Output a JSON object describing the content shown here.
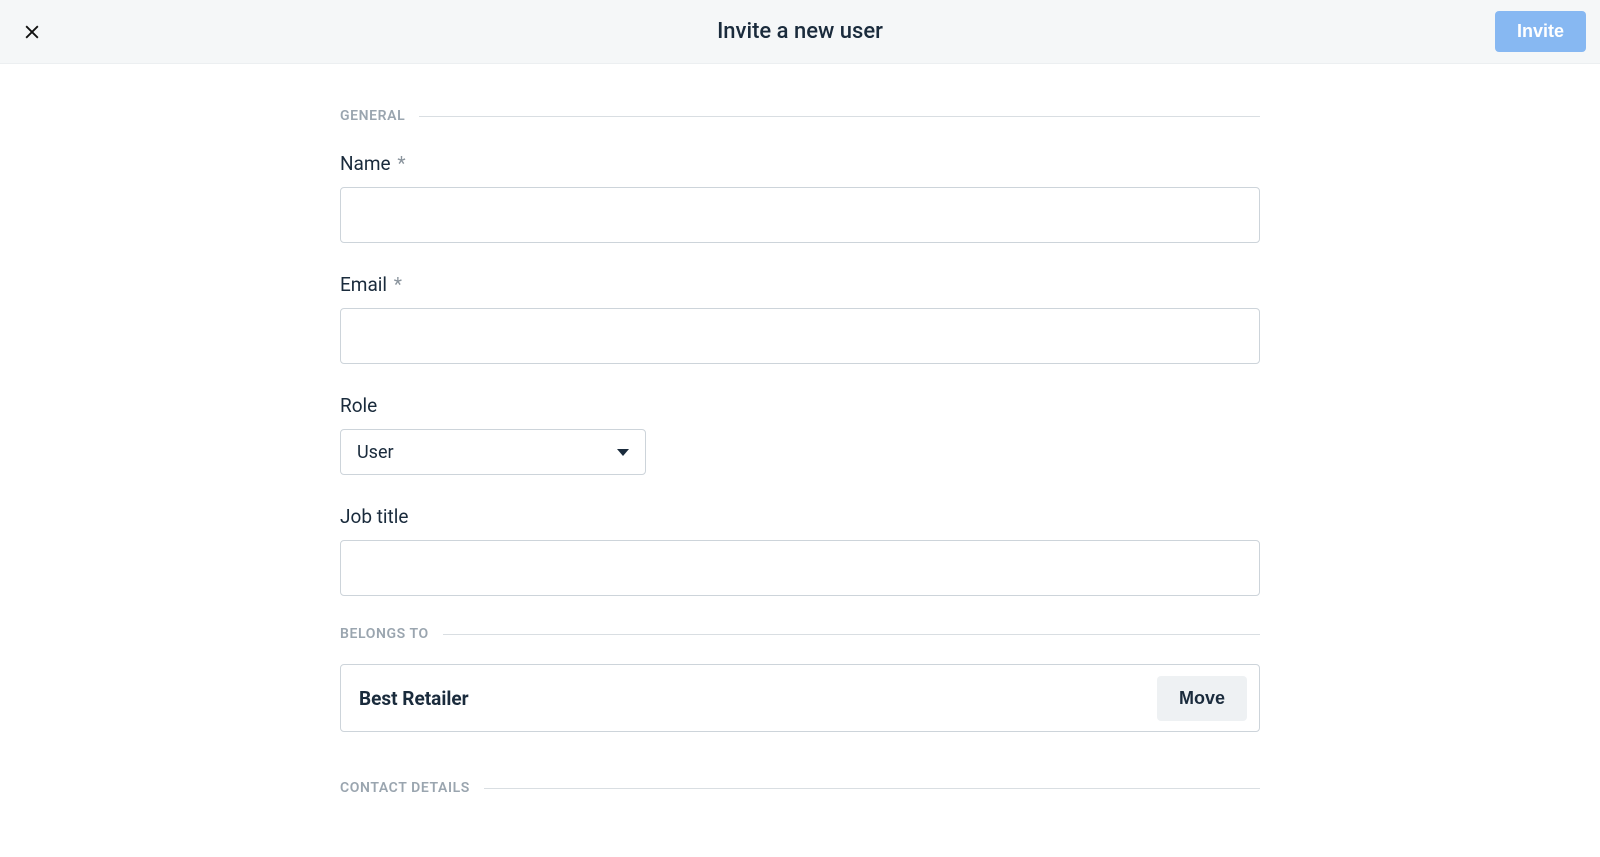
{
  "header": {
    "title": "Invite a new user",
    "invite_label": "Invite"
  },
  "sections": {
    "general": "GENERAL",
    "belongs_to": "BELONGS TO",
    "contact_details": "CONTACT DETAILS"
  },
  "fields": {
    "name": {
      "label": "Name",
      "required_mark": "*",
      "value": ""
    },
    "email": {
      "label": "Email",
      "required_mark": "*",
      "value": ""
    },
    "role": {
      "label": "Role",
      "selected": "User"
    },
    "job_title": {
      "label": "Job title",
      "value": ""
    }
  },
  "belongs_to": {
    "organization": "Best Retailer",
    "move_label": "Move"
  }
}
